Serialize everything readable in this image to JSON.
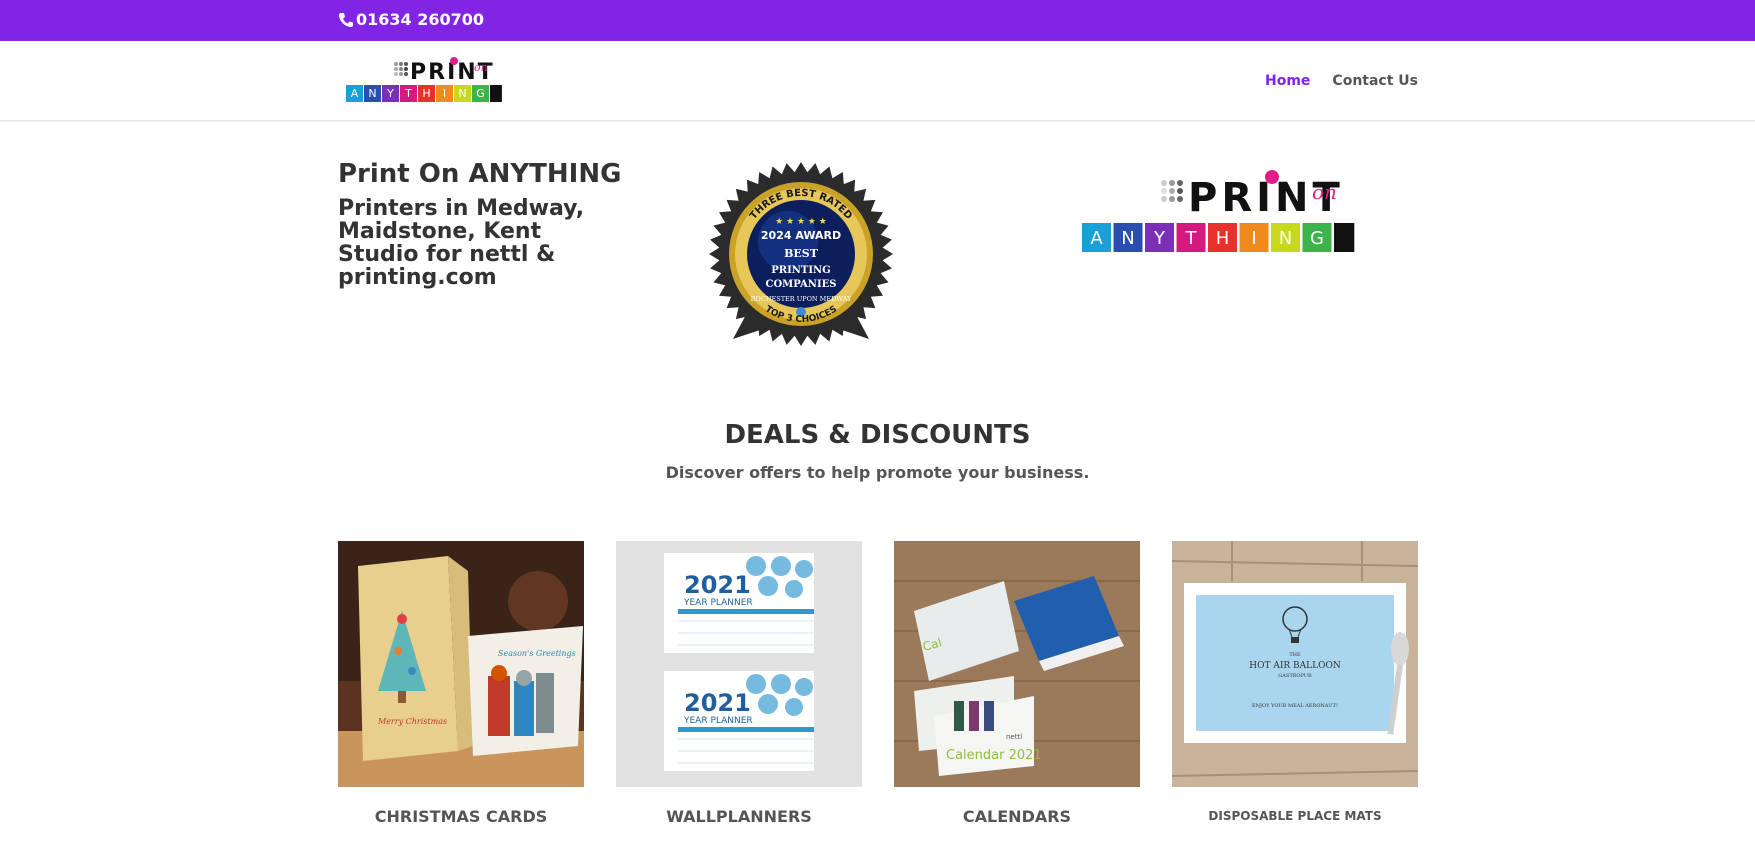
{
  "topbar": {
    "phone": "01634 260700",
    "phone_icon": "phone-icon",
    "bg": "#8224e3"
  },
  "header": {
    "logo_alt": "Print on ANYTHING",
    "nav": [
      {
        "label": "Home",
        "active": true
      },
      {
        "label": "Contact Us",
        "active": false
      }
    ]
  },
  "hero": {
    "title": "Print On ANYTHING",
    "subtitle": "Printers in Medway, Maidstone, Kent Studio for nettl & printing.com",
    "badge": {
      "arc_top": "THREE BEST RATED",
      "year": "2024 AWARD",
      "line1": "BEST",
      "line2": "PRINTING",
      "line3": "COMPANIES",
      "location": "ROCHESTER UPON MEDWAY",
      "ribbon": "TOP 3 CHOICES"
    }
  },
  "deals": {
    "title": "DEALS & DISCOUNTS",
    "subtitle": "Discover offers to help promote your business."
  },
  "products": [
    {
      "label": "CHRISTMAS CARDS",
      "card_text1": "Merry Christmas",
      "card_text2": "Season's Greetings"
    },
    {
      "label": "WALLPLANNERS",
      "year": "2021",
      "caption": "YEAR PLANNER"
    },
    {
      "label": "CALENDARS",
      "caption": "Calendar 2021",
      "brand": "nettl"
    },
    {
      "label": "DISPOSABLE PLACE MATS",
      "mat_the": "THE",
      "mat_title": "HOT AIR BALLOON",
      "mat_sub": "GASTROPUB",
      "mat_footer": "ENJOY YOUR MEAL AERONAUT!"
    }
  ],
  "logo_letters": [
    "A",
    "N",
    "Y",
    "T",
    "H",
    "I",
    "N",
    "G"
  ],
  "logo_colors": [
    "#1aa0d8",
    "#2a4fb0",
    "#7b2fb5",
    "#d6197e",
    "#e8312c",
    "#f08a1c",
    "#c8d81a",
    "#3bb54a"
  ]
}
